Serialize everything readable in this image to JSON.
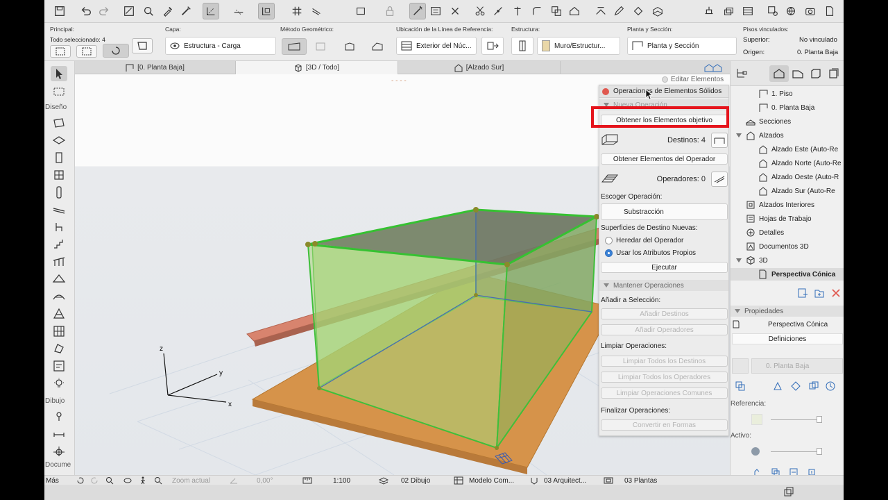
{
  "infobox": {
    "principal_label": "Principal:",
    "selected_count": "Todo seleccionado: 4",
    "capa_label": "Capa:",
    "capa_value": "Estructura - Carga",
    "metodo_label": "Método Geométrico:",
    "ubicacion_label": "Ubicación de la Línea de Referencia:",
    "ubicacion_value": "Exterior del Núc...",
    "estructura_label": "Estructura:",
    "estructura_value": "Muro/Estructur...",
    "planta_label": "Planta y Sección:",
    "planta_value": "Planta y Sección",
    "pisos_label": "Pisos vinculados:",
    "superior_label": "Superior:",
    "superior_value": "No vinculado",
    "origen_label": "Origen:",
    "origen_value": "0. Planta Baja"
  },
  "toolbox": {
    "sections": [
      "Diseño",
      "Dibujo",
      "Docume",
      "Más"
    ]
  },
  "tabs": [
    {
      "label": "[0. Planta Baja]",
      "icon": "floorplan-icon"
    },
    {
      "label": "[3D / Todo]",
      "icon": "cube-icon"
    },
    {
      "label": "[Alzado Sur]",
      "icon": "elevation-icon"
    }
  ],
  "viewport": {
    "axis_x": "x",
    "axis_y": "y",
    "axis_z": "z",
    "dash_marker": "- - - -"
  },
  "editar_elementos": "Editar Elementos",
  "ops_palette": {
    "title": "Operaciones de Elementos Sólidos",
    "nueva_operacion": "Nueva Operación",
    "obtener_objetivo": "Obtener los Elementos objetivo",
    "destinos_label": "Destinos: 4",
    "obtener_operador": "Obtener Elementos del Operador",
    "operadores_label": "Operadores: 0",
    "escoger_label": "Escoger Operación:",
    "operation_value": "Substracción",
    "superficies_label": "Superficies de Destino Nuevas:",
    "heredar_label": "Heredar del Operador",
    "usar_label": "Usar los Atributos Propios",
    "ejecutar": "Ejecutar",
    "mantener_head": "Mantener Operaciones",
    "anadir_label": "Añadir a Selección:",
    "anadir_destinos": "Añadir Destinos",
    "anadir_operadores": "Añadir Operadores",
    "limpiar_label": "Limpiar Operaciones:",
    "limpiar_destinos": "Limpiar Todos los Destinos",
    "limpiar_operadores": "Limpiar Todos los Operadores",
    "limpiar_comunes": "Limpiar Operaciones Comunes",
    "finalizar_label": "Finalizar Operaciones:",
    "convertir": "Convertir en Formas"
  },
  "navigator": {
    "items": [
      {
        "label": "1. Piso",
        "icon": "floorplan-icon",
        "indent": 2
      },
      {
        "label": "0. Planta Baja",
        "icon": "floorplan-icon",
        "indent": 2
      },
      {
        "label": "Secciones",
        "icon": "section-icon",
        "indent": 1
      },
      {
        "label": "Alzados",
        "icon": "elevation-icon",
        "indent": 1
      },
      {
        "label": "Alzado Este (Auto-Re",
        "icon": "elevation-icon",
        "indent": 2
      },
      {
        "label": "Alzado Norte (Auto-Re",
        "icon": "elevation-icon",
        "indent": 2
      },
      {
        "label": "Alzado Oeste (Auto-R",
        "icon": "elevation-icon",
        "indent": 2
      },
      {
        "label": "Alzado Sur (Auto-Re",
        "icon": "elevation-icon",
        "indent": 2
      },
      {
        "label": "Alzados Interiores",
        "icon": "interior-elevation-icon",
        "indent": 1
      },
      {
        "label": "Hojas de Trabajo",
        "icon": "worksheet-icon",
        "indent": 1
      },
      {
        "label": "Detalles",
        "icon": "detail-icon",
        "indent": 1
      },
      {
        "label": "Documentos 3D",
        "icon": "document-3d-icon",
        "indent": 1
      },
      {
        "label": "3D",
        "icon": "cube-icon",
        "indent": 1
      },
      {
        "label": "Perspectiva Cónica",
        "icon": "perspective-icon",
        "indent": 2
      }
    ],
    "propiedades_head": "Propiedades",
    "propiedades_value": "Perspectiva Cónica",
    "definiciones": "Definiciones",
    "floor_field": "0. Planta Baja",
    "referencia_label": "Referencia:",
    "activo_label": "Activo:"
  },
  "statusbar": {
    "zoom": "Zoom actual",
    "angle": "0,00°",
    "scale": "1:100",
    "layer_combo": "02 Dibujo",
    "model_view": "Modelo Com...",
    "pen_set": "03 Arquitect...",
    "plot": "03 Plantas"
  },
  "colors": {
    "wall_green": "#9fd06a",
    "slab_orange": "#d6934a",
    "beam_salmon": "#d8846e",
    "highlight_red": "#e5141c"
  }
}
